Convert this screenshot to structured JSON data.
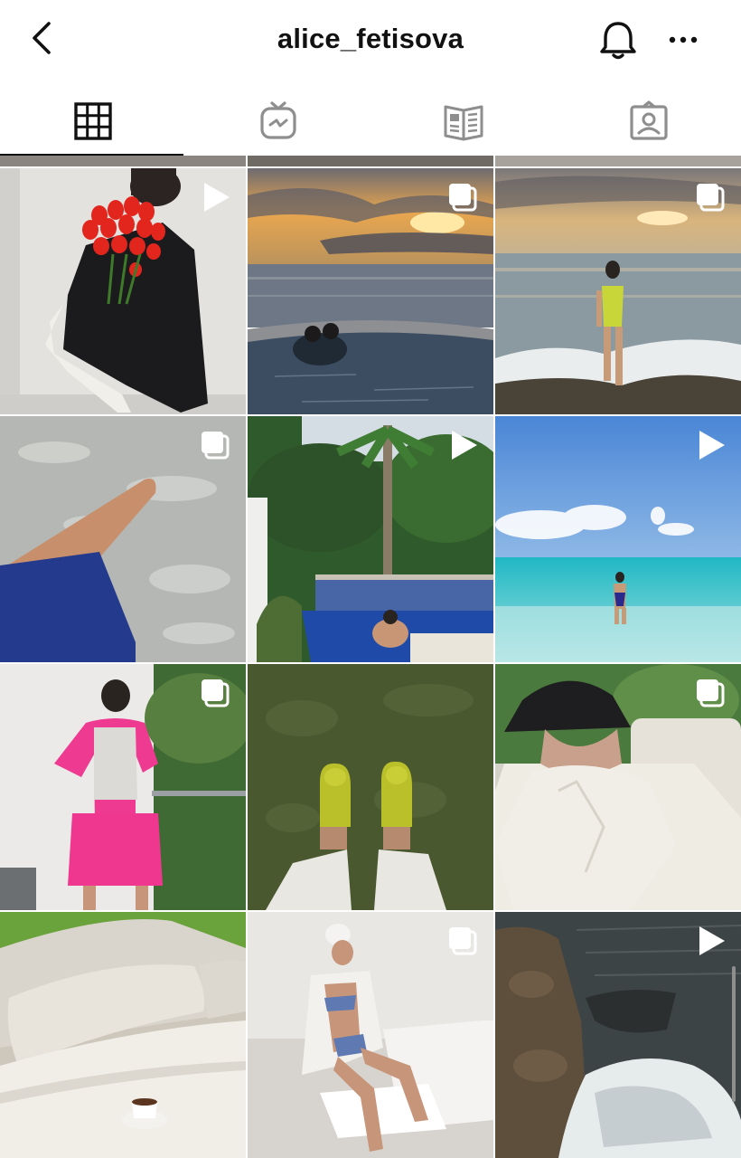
{
  "header": {
    "username": "alice_fetisova",
    "icons": {
      "back": "chevron-left-icon",
      "notifications": "bell-icon",
      "more": "more-horizontal-icon"
    }
  },
  "tabs": [
    {
      "name": "posts-grid",
      "icon": "grid-icon",
      "active": true
    },
    {
      "name": "igtv",
      "icon": "tv-icon",
      "active": false
    },
    {
      "name": "guides",
      "icon": "guide-book-icon",
      "active": false
    },
    {
      "name": "tagged",
      "icon": "tagged-person-icon",
      "active": false
    }
  ],
  "grid": {
    "posts": [
      {
        "id": "tulips",
        "type": "reel",
        "badge_icon": "play-icon"
      },
      {
        "id": "sunset-pool",
        "type": "carousel",
        "badge_icon": "carousel-icon"
      },
      {
        "id": "beach-swimsuit",
        "type": "carousel",
        "badge_icon": "carousel-icon"
      },
      {
        "id": "arm-water",
        "type": "carousel",
        "badge_icon": "carousel-icon"
      },
      {
        "id": "palm-pool",
        "type": "reel",
        "badge_icon": "play-icon"
      },
      {
        "id": "turquoise-sea",
        "type": "reel",
        "badge_icon": "play-icon"
      },
      {
        "id": "pink-outfit",
        "type": "carousel",
        "badge_icon": "carousel-icon"
      },
      {
        "id": "green-boots",
        "type": "photo",
        "badge_icon": ""
      },
      {
        "id": "bucket-hat",
        "type": "carousel",
        "badge_icon": "carousel-icon"
      },
      {
        "id": "sofa-coffee",
        "type": "photo",
        "badge_icon": ""
      },
      {
        "id": "bikini-chair",
        "type": "carousel",
        "badge_icon": "carousel-icon"
      },
      {
        "id": "rocky-shore",
        "type": "reel",
        "badge_icon": "play-icon"
      }
    ]
  },
  "colors": {
    "text": "#111111",
    "icon_inactive": "#8e8e8e",
    "background": "#ffffff"
  }
}
